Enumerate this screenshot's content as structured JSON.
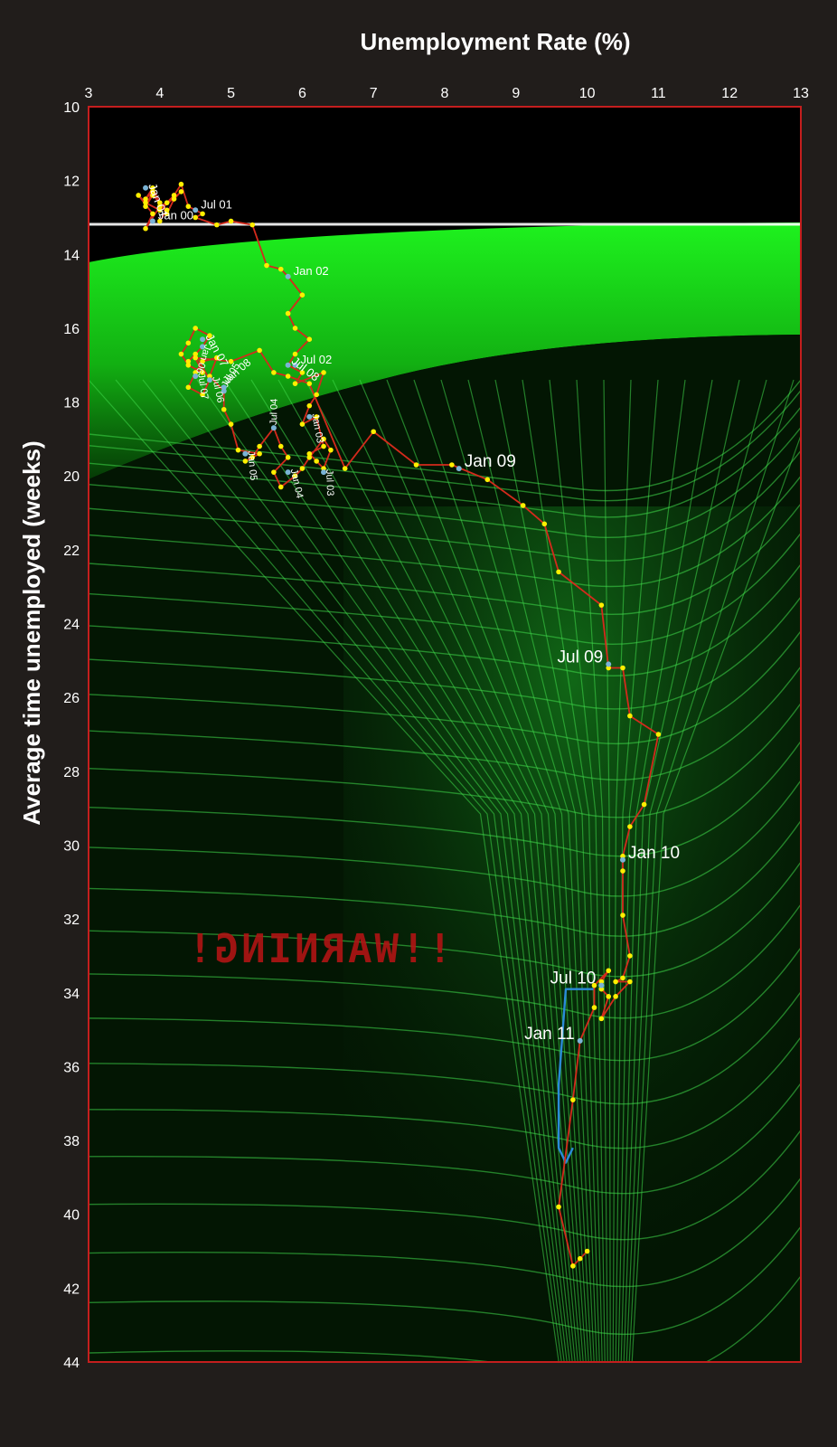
{
  "chart_data": {
    "type": "line",
    "title": "",
    "xlabel": "Unemployment Rate (%)",
    "ylabel": "Average time unemployed (weeks)",
    "xlim": [
      3,
      13
    ],
    "ylim": [
      10,
      44
    ],
    "y_inverted": true,
    "x_ticks": [
      3,
      4,
      5,
      6,
      7,
      8,
      9,
      10,
      11,
      12,
      13
    ],
    "y_ticks": [
      10,
      12,
      14,
      16,
      18,
      20,
      22,
      24,
      26,
      28,
      30,
      32,
      34,
      36,
      38,
      40,
      42,
      44
    ],
    "x_axis_position": "top",
    "grid": false,
    "background_caption": "!!WARNING!",
    "colors": {
      "line": "#d42a1c",
      "monthly_point": "#ffef00",
      "labeled_point": "#7ab3d6",
      "projection_line": "#2a8ad8",
      "frame": "#c41e1e",
      "surface_glow": "#18e61e",
      "page_background": "#211d1b"
    },
    "series": [
      {
        "values": [
          [
            4.0,
            13.1
          ],
          [
            4.1,
            12.8
          ],
          [
            3.9,
            12.4
          ],
          [
            3.8,
            12.7
          ],
          [
            3.9,
            12.3
          ],
          [
            3.8,
            12.5
          ],
          [
            3.9,
            12.2
          ],
          [
            4.0,
            12.6
          ],
          [
            4.1,
            12.9
          ],
          [
            4.2,
            12.5
          ],
          [
            4.3,
            12.3
          ],
          [
            4.0,
            12.8
          ],
          [
            3.8,
            12.6
          ],
          [
            3.7,
            12.4
          ],
          [
            3.9,
            12.9
          ],
          [
            3.8,
            13.3
          ],
          [
            4.0,
            12.7
          ],
          [
            4.1,
            12.6
          ],
          [
            4.2,
            12.4
          ],
          [
            4.3,
            12.1
          ],
          [
            4.4,
            12.7
          ],
          [
            4.6,
            12.9
          ],
          [
            4.5,
            13.0
          ],
          [
            4.8,
            13.2
          ],
          [
            5.0,
            13.1
          ],
          [
            5.3,
            13.2
          ],
          [
            5.5,
            14.3
          ],
          [
            5.7,
            14.4
          ],
          [
            5.8,
            14.6
          ],
          [
            6.0,
            15.1
          ],
          [
            5.8,
            15.6
          ],
          [
            5.9,
            16.0
          ],
          [
            6.1,
            16.3
          ],
          [
            5.9,
            16.7
          ],
          [
            5.8,
            17.0
          ],
          [
            6.0,
            17.2
          ],
          [
            5.9,
            17.5
          ],
          [
            6.3,
            17.2
          ],
          [
            6.2,
            17.8
          ],
          [
            6.1,
            18.1
          ],
          [
            6.0,
            18.6
          ],
          [
            6.2,
            18.4
          ],
          [
            6.3,
            19.2
          ],
          [
            6.1,
            19.4
          ],
          [
            6.2,
            19.6
          ],
          [
            6.3,
            19.8
          ],
          [
            6.4,
            19.3
          ],
          [
            6.3,
            19.0
          ],
          [
            6.1,
            19.5
          ],
          [
            6.0,
            19.8
          ],
          [
            5.9,
            20.0
          ],
          [
            5.7,
            20.3
          ],
          [
            5.6,
            19.9
          ],
          [
            5.8,
            19.5
          ],
          [
            5.7,
            19.2
          ],
          [
            5.6,
            18.7
          ],
          [
            5.4,
            19.2
          ],
          [
            5.3,
            19.5
          ],
          [
            5.2,
            19.6
          ],
          [
            5.4,
            19.4
          ],
          [
            5.1,
            19.3
          ],
          [
            5.0,
            18.6
          ],
          [
            4.9,
            18.2
          ],
          [
            4.9,
            17.7
          ],
          [
            4.7,
            17.3
          ],
          [
            4.8,
            16.8
          ],
          [
            4.6,
            16.9
          ],
          [
            4.5,
            17.2
          ],
          [
            4.4,
            17.6
          ],
          [
            4.6,
            17.8
          ],
          [
            4.7,
            17.4
          ],
          [
            4.5,
            16.7
          ],
          [
            4.4,
            16.9
          ],
          [
            4.6,
            16.5
          ],
          [
            4.7,
            16.2
          ],
          [
            4.5,
            16.0
          ],
          [
            4.4,
            16.4
          ],
          [
            4.3,
            16.7
          ],
          [
            4.4,
            17.0
          ],
          [
            4.6,
            17.2
          ],
          [
            4.5,
            16.8
          ],
          [
            5.0,
            16.9
          ],
          [
            5.4,
            16.6
          ],
          [
            5.6,
            17.2
          ],
          [
            5.8,
            17.3
          ],
          [
            6.1,
            17.5
          ],
          [
            6.6,
            19.8
          ],
          [
            7.0,
            18.8
          ],
          [
            7.6,
            19.7
          ],
          [
            8.1,
            19.7
          ],
          [
            8.6,
            20.1
          ],
          [
            9.1,
            20.8
          ],
          [
            9.4,
            21.3
          ],
          [
            9.6,
            22.6
          ],
          [
            10.2,
            23.5
          ],
          [
            10.3,
            25.2
          ],
          [
            10.5,
            25.2
          ],
          [
            10.6,
            26.5
          ],
          [
            11.0,
            27.0
          ],
          [
            10.8,
            28.9
          ],
          [
            10.6,
            29.5
          ],
          [
            10.5,
            30.3
          ],
          [
            10.5,
            30.7
          ],
          [
            10.5,
            31.9
          ],
          [
            10.6,
            33.0
          ],
          [
            10.5,
            33.6
          ],
          [
            10.4,
            33.7
          ],
          [
            10.6,
            33.7
          ],
          [
            10.4,
            34.1
          ],
          [
            10.2,
            34.7
          ],
          [
            10.3,
            34.1
          ],
          [
            10.2,
            33.9
          ],
          [
            10.2,
            33.7
          ],
          [
            10.3,
            33.4
          ],
          [
            10.1,
            33.8
          ],
          [
            10.1,
            34.4
          ],
          [
            9.9,
            35.3
          ],
          [
            9.8,
            36.9
          ],
          [
            9.6,
            39.8
          ],
          [
            9.8,
            41.4
          ],
          [
            9.9,
            41.2
          ],
          [
            10.0,
            41.0
          ]
        ]
      }
    ],
    "projection_path": [
      [
        10.1,
        33.9
      ],
      [
        9.7,
        33.9
      ],
      [
        9.6,
        36.5
      ],
      [
        9.6,
        38.2
      ],
      [
        9.7,
        38.6
      ],
      [
        9.8,
        38.2
      ]
    ],
    "annotations": [
      {
        "text": "Jan 00",
        "x": 3.9,
        "y": 13.1,
        "size": 13,
        "rotate": 0
      },
      {
        "text": "Jan 01",
        "x": 3.8,
        "y": 12.2,
        "size": 13,
        "rotate": 70
      },
      {
        "text": "Jul 01",
        "x": 4.5,
        "y": 12.8,
        "size": 13,
        "rotate": 0
      },
      {
        "text": "Jan 02",
        "x": 5.8,
        "y": 14.6,
        "size": 13,
        "rotate": 0
      },
      {
        "text": "Jul 02",
        "x": 5.9,
        "y": 17.0,
        "size": 13,
        "rotate": 0
      },
      {
        "text": "Jan 03",
        "x": 6.1,
        "y": 18.4,
        "size": 11,
        "rotate": 80
      },
      {
        "text": "Jul 03",
        "x": 6.3,
        "y": 19.9,
        "size": 11,
        "rotate": 88
      },
      {
        "text": "Jan 04",
        "x": 5.8,
        "y": 19.9,
        "size": 11,
        "rotate": 78
      },
      {
        "text": "Jul 04",
        "x": 5.6,
        "y": 18.7,
        "size": 11,
        "rotate": -88
      },
      {
        "text": "Jan 05",
        "x": 5.2,
        "y": 19.4,
        "size": 11,
        "rotate": 85
      },
      {
        "text": "Jul 05",
        "x": 4.9,
        "y": 17.7,
        "size": 11,
        "rotate": -60
      },
      {
        "text": "Jan 06",
        "x": 4.6,
        "y": 16.5,
        "size": 11,
        "rotate": 108
      },
      {
        "text": "Jul 06",
        "x": 4.7,
        "y": 17.4,
        "size": 11,
        "rotate": 78
      },
      {
        "text": "Jan 07",
        "x": 4.6,
        "y": 16.3,
        "size": 13,
        "rotate": 62
      },
      {
        "text": "Jul 07",
        "x": 4.5,
        "y": 17.3,
        "size": 11,
        "rotate": 82
      },
      {
        "text": "Jan 08",
        "x": 4.9,
        "y": 17.6,
        "size": 12,
        "rotate": -40
      },
      {
        "text": "Jul 08",
        "x": 5.8,
        "y": 17.0,
        "size": 13,
        "rotate": 38
      },
      {
        "text": "Jan 09",
        "x": 8.2,
        "y": 19.8,
        "size": 19,
        "rotate": 0
      },
      {
        "text": "Jul 09",
        "x": 10.3,
        "y": 25.1,
        "size": 19,
        "rotate": 0
      },
      {
        "text": "Jan 10",
        "x": 10.5,
        "y": 30.4,
        "size": 19,
        "rotate": 0
      },
      {
        "text": "Jul 10",
        "x": 10.2,
        "y": 33.8,
        "size": 19,
        "rotate": 0
      },
      {
        "text": "Jan 11",
        "x": 9.9,
        "y": 35.3,
        "size": 19,
        "rotate": 0
      }
    ]
  }
}
